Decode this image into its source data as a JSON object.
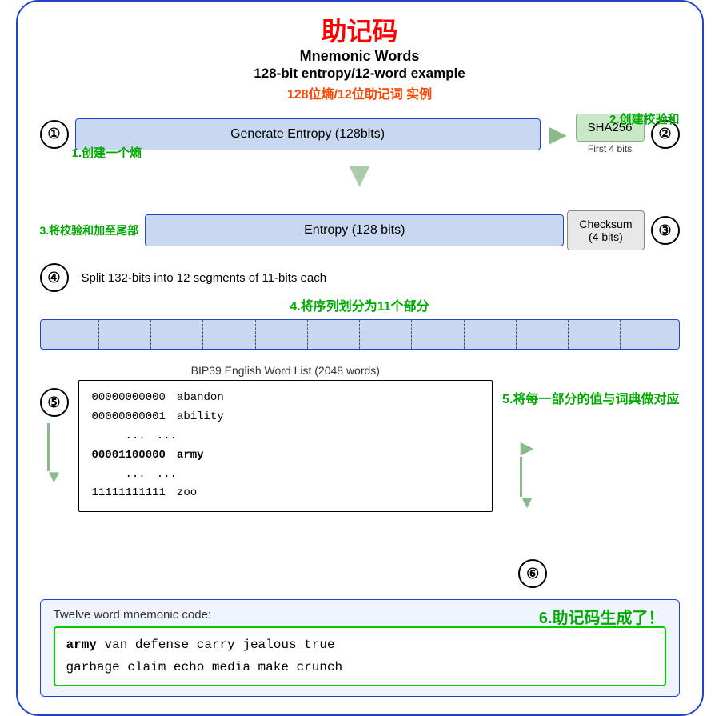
{
  "title": {
    "main": "助记码",
    "sub1": "Mnemonic Words",
    "sub2": "128-bit entropy/12-word example",
    "sub_cn": "128位熵/12位助记词 实例"
  },
  "step1": {
    "circle": "①",
    "box": "Generate Entropy (128bits)",
    "label": "1.创建一个熵"
  },
  "step2": {
    "circle": "②",
    "sha_box": "SHA256",
    "sha_sub": "First 4 bits",
    "label": "2.创建校验和"
  },
  "step3": {
    "circle": "③",
    "label": "3.将校验和加至尾部",
    "entropy_box": "Entropy (128 bits)",
    "checksum_box": "Checksum\n(4 bits)"
  },
  "step4": {
    "circle": "④",
    "label": "Split 132-bits into 12 segments of 11-bits each",
    "label_cn": "4.将序列划分为11个部分"
  },
  "step5": {
    "circle": "⑤",
    "bip39_label": "BIP39 English Word List (2048 words)",
    "label_cn": "5.将每一部分的值与词典做对应",
    "rows": [
      {
        "bits": "00000000000",
        "word": "abandon"
      },
      {
        "bits": "00000000001",
        "word": "ability"
      },
      {
        "bits": "...",
        "word": "..."
      },
      {
        "bits": "00001100000",
        "word": "army",
        "bold": true
      },
      {
        "bits": "...",
        "word": "..."
      },
      {
        "bits": "11111111111",
        "word": "zoo"
      }
    ]
  },
  "step6": {
    "circle": "⑥",
    "label": "6.助记码生成了！",
    "title": "Twelve word mnemonic code:",
    "mnemonic_first": "army",
    "mnemonic_rest": " van defense carry jealous true\ngarbage claim echo media make crunch"
  }
}
